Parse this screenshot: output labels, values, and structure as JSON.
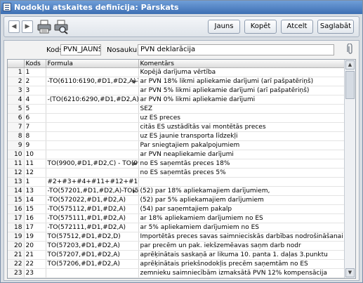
{
  "window": {
    "title": "Nodokļu atskaites definīcija: Pārskats"
  },
  "toolbar": {
    "prev_icon": "left-arrow-icon",
    "next_icon": "right-arrow-icon",
    "buttons": {
      "new": "Jauns",
      "copy": "Kopēt",
      "cancel": "Atcelt",
      "save": "Saglabāt"
    }
  },
  "header": {
    "code_label": "Kods",
    "code_value": "PVN_JAUNS",
    "name_label": "Nosaukums",
    "name_value": "PVN deklarācija"
  },
  "table": {
    "columns": [
      "",
      "Kods",
      "Formula",
      "Komentārs"
    ],
    "rows": [
      [
        "1",
        "1",
        "",
        "Kopējā darījuma vērtība"
      ],
      [
        "2",
        "2",
        "-TO(6110:6190,#D1,#D2,A)-TO(5",
        "ar PVN 18% likmi apliekamie darījumi (arī pašpatēriņš)"
      ],
      [
        "3",
        "3",
        "",
        "ar PVN 5% likmi apliekamie darījumi (arī pašpatēriņš)"
      ],
      [
        "4",
        "4",
        "-(TO(6210:6290,#D1,#D2,A))",
        "ar PVN 0% likmi apliekamie darījumi"
      ],
      [
        "5",
        "5",
        "",
        "SEZ"
      ],
      [
        "6",
        "6",
        "",
        "uz ES preces"
      ],
      [
        "7",
        "7",
        "",
        "citās ES uzstādītās vai montētās preces"
      ],
      [
        "8",
        "8",
        "",
        "uz ES jaunie transporta līdzekļi"
      ],
      [
        "9",
        "9",
        "",
        "Par sniegtajiem pakalpojumiem"
      ],
      [
        "10",
        "10",
        "",
        "ar PVN neapliekamie darījumi"
      ],
      [
        "11",
        "11",
        "TO(9900,#D1,#D2,C) - TO(9901,#",
        "no ES saņemtās preces 18%"
      ],
      [
        "12",
        "12",
        "",
        "no ES saņemtās preces 5%"
      ],
      [
        "13",
        "1",
        "#2+#3+#4+#11+#12+#10",
        ""
      ],
      [
        "14",
        "13",
        "-TO(57201,#D1,#D2,A)-TO(57515",
        "(52) par 18% apliekamajiem darījumiem,"
      ],
      [
        "15",
        "14",
        "-TO(572022,#D1,#D2,A)",
        "(52) par 5% apliekamajiem darījumiem"
      ],
      [
        "16",
        "15",
        "-TO(575112,#D1,#D2,A)",
        "(54) par saņemtajiem pakalp"
      ],
      [
        "17",
        "16",
        "-TO(575111,#D1,#D2,A)",
        "ar 18%  apliekamiem darījumiem no ES"
      ],
      [
        "18",
        "17",
        "-TO(572111,#D1,#D2,A)",
        "ar 5%  apliekamiem darījumiem no ES"
      ],
      [
        "19",
        "19",
        "TO(57512,#D1,#D2,D)",
        "Importētās preces savas saimnieciskās darbības nodrošināšanai"
      ],
      [
        "20",
        "20",
        "TO(57203,#D1,#D2,A)",
        "par precēm un pak. iekšzemēavas saņm darb nodr"
      ],
      [
        "21",
        "21",
        "TO(57207,#D1,#D2,A)",
        "aprēķinātais saskaņā ar likuma 10. panta 1. daļas 3.punktu"
      ],
      [
        "22",
        "22",
        "TO(57206,#D1,#D2,A)",
        "aprēķinātais priekšnodokļis precēm saņemtām no ES"
      ],
      [
        "23",
        "23",
        "",
        "zemnieku saimniecībām izmaksātā PVN 12% kompensācija"
      ]
    ],
    "arrow_rows": [
      1,
      10,
      13
    ]
  }
}
